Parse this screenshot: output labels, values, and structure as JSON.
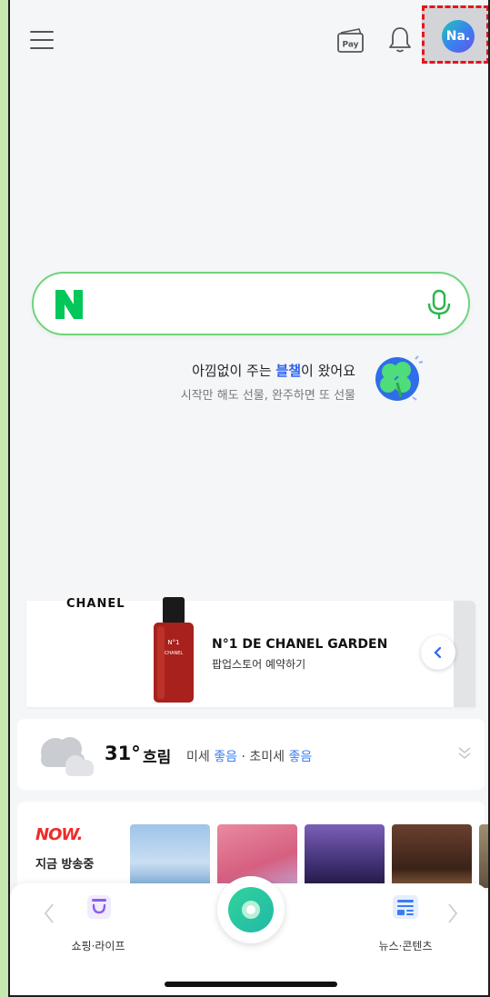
{
  "header": {
    "pay_label": "Pay",
    "profile_initials": "Na."
  },
  "search": {
    "logo_letter": "N",
    "placeholder": ""
  },
  "promo": {
    "title_prefix": "아낌없이 주는 ",
    "title_highlight": "블챌",
    "title_suffix": "이 왔어요",
    "subtitle": "시작만 해도 선물, 완주하면 또 선물"
  },
  "ad": {
    "brand": "CHANEL",
    "title": "N°1 DE CHANEL GARDEN",
    "subtitle": "팝업스토어 예약하기",
    "bottle_label_1": "N°1",
    "bottle_label_2": "CHANEL"
  },
  "weather": {
    "temperature": "31°",
    "condition": "흐림",
    "fine_dust_label": "미세",
    "fine_dust_value": "좋음",
    "separator": "·",
    "ultrafine_dust_label": "초미세",
    "ultrafine_dust_value": "좋음"
  },
  "now": {
    "logo": "NOW.",
    "live_label": "지금 방송중"
  },
  "bottom_nav": {
    "left_label": "쇼핑·라이프",
    "right_label": "뉴스·콘텐츠"
  },
  "colors": {
    "naver_green": "#03c75a",
    "search_border": "#6fd47a",
    "highlight_blue": "#2e63ef",
    "now_red": "#ef2b2b",
    "profile_dash": "#e8141c"
  },
  "icons": [
    "menu-icon",
    "pay-icon",
    "bell-icon",
    "mic-icon",
    "clover-icon",
    "cloud-icon",
    "chevron-down-icon",
    "shopping-bag-icon",
    "news-icon",
    "chevron-left-icon",
    "chevron-right-icon"
  ]
}
